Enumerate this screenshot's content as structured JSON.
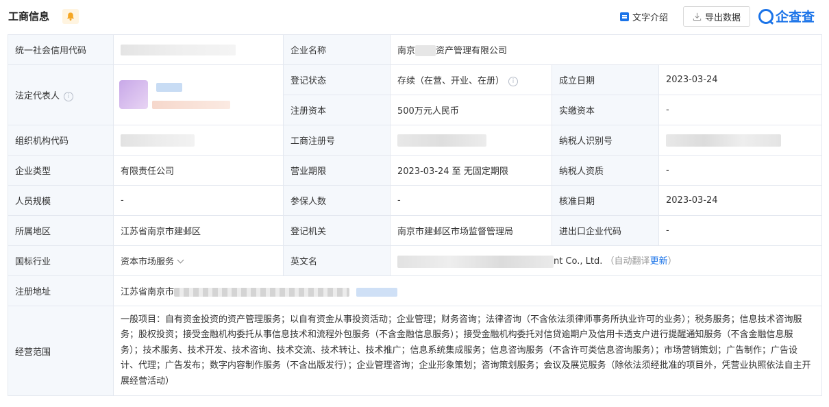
{
  "header": {
    "title": "工商信息",
    "text_intro": "文字介绍",
    "export": "导出数据",
    "brand": "企查查"
  },
  "colors": {
    "accent": "#1a73e8",
    "label_bg": "#f5f8fc",
    "border": "#e4e8f0",
    "bell": "#f5a623"
  },
  "rows": {
    "r1": {
      "l1": "统一社会信用代码",
      "v1": "",
      "l2": "企业名称",
      "v2_a": "南京",
      "v2_b": "资产管理有限公司"
    },
    "r2": {
      "l1": "法定代表人",
      "l2": "登记状态",
      "v2": "存续（在营、开业、在册）",
      "l3": "成立日期",
      "v3": "2023-03-24"
    },
    "r3": {
      "l2": "注册资本",
      "v2": "500万元人民币",
      "l3": "实缴资本",
      "v3": "-"
    },
    "r4": {
      "l1": "组织机构代码",
      "l2": "工商注册号",
      "l3": "纳税人识别号"
    },
    "r5": {
      "l1": "企业类型",
      "v1": "有限责任公司",
      "l2": "营业期限",
      "v2": "2023-03-24 至 无固定期限",
      "l3": "纳税人资质",
      "v3": "-"
    },
    "r6": {
      "l1": "人员规模",
      "v1": "-",
      "l2": "参保人数",
      "v2": "-",
      "l3": "核准日期",
      "v3": "2023-03-24"
    },
    "r7": {
      "l1": "所属地区",
      "v1": "江苏省南京市建邺区",
      "l2": "登记机关",
      "v2": "南京市建邺区市场监督管理局",
      "l3": "进出口企业代码",
      "v3": "-"
    },
    "r8": {
      "l1": "国标行业",
      "v1": "资本市场服务",
      "l2": "英文名",
      "v2_tail": "nt Co., Ltd.",
      "v2_note_a": "（自动翻译",
      "v2_note_link": "更新",
      "v2_note_b": "）"
    },
    "r9": {
      "l1": "注册地址",
      "v1": "江苏省南京市"
    },
    "r10": {
      "l1": "经营范围",
      "v1": "一般项目：自有资金投资的资产管理服务；以自有资金从事投资活动；企业管理；财务咨询；法律咨询（不含依法须律师事务所执业许可的业务）；税务服务；信息技术咨询服务；股权投资；接受金融机构委托从事信息技术和流程外包服务（不含金融信息服务）；接受金融机构委托对信贷逾期户及信用卡透支户进行提醒通知服务（不含金融信息服务）；技术服务、技术开发、技术咨询、技术交流、技术转让、技术推广；信息系统集成服务；信息咨询服务（不含许可类信息咨询服务）；市场营销策划；广告制作；广告设计、代理；广告发布；数字内容制作服务（不含出版发行）；企业管理咨询；企业形象策划；咨询策划服务；会议及展览服务（除依法须经批准的项目外，凭营业执照依法自主开展经营活动）"
    }
  }
}
